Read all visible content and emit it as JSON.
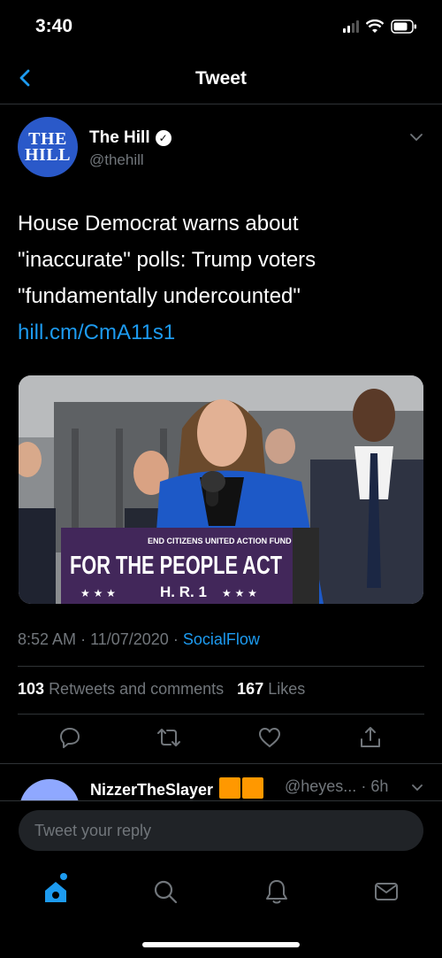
{
  "status": {
    "time": "3:40"
  },
  "nav": {
    "title": "Tweet"
  },
  "author": {
    "avatar_text": "THE HILL",
    "name": "The Hill",
    "handle": "@thehill"
  },
  "tweet": {
    "text": "House Democrat warns about \"inaccurate\" polls: Trump voters \"fundamentally undercounted\"",
    "link": "hill.cm/CmA11s1",
    "time": "8:52 AM",
    "date": "11/07/2020",
    "source": "SocialFlow",
    "retweets_count": "103",
    "retweets_label": "Retweets and comments",
    "likes_count": "167",
    "likes_label": "Likes"
  },
  "image": {
    "sign_small": "END CITIZENS UNITED ACTION FUND",
    "sign_main": "FOR THE PEOPLE ACT",
    "sign_sub": "H. R. 1"
  },
  "reply": {
    "name": "NizzerTheSlayer",
    "handle": "@heyes...",
    "time": "6h"
  },
  "compose": {
    "placeholder": "Tweet your reply"
  },
  "colors": {
    "accent": "#1d9bf0",
    "background": "#000000",
    "avatar": "#2a59c9"
  }
}
